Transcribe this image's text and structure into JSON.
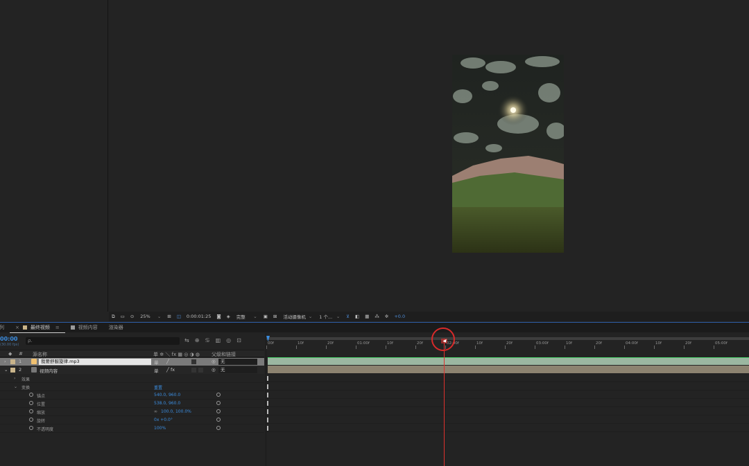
{
  "viewer_bar": {
    "zoom": "25%",
    "timecode": "0:00:01:25",
    "resolution": "完整",
    "camera": "活动摄像机",
    "views": "1 个...",
    "exposure": "+0.0"
  },
  "tabs": [
    {
      "label": "队列"
    },
    {
      "label": "最终视频",
      "active": true
    },
    {
      "label": "视频内容"
    },
    {
      "label": "渲染器"
    }
  ],
  "timeline": {
    "timecode": "00:00",
    "timecode_sub": "(30.00 fps)",
    "search_placeholder": "ρ.",
    "columns": {
      "source_name": "源名称",
      "parent": "父级和链接"
    },
    "layers": [
      {
        "index": "1",
        "name": "我要舒服旋律.mp3",
        "parent": "无",
        "color": "#c9b48a",
        "selected": true
      },
      {
        "index": "2",
        "name": "视频内容",
        "parent": "无",
        "color": "#c9b48a",
        "selected": false
      }
    ],
    "groups": {
      "effects": "效果",
      "transform": "变换",
      "reset": "重置"
    },
    "properties": [
      {
        "name": "锚点",
        "value": "540.0, 960.0"
      },
      {
        "name": "位置",
        "value": "538.0, 960.0"
      },
      {
        "name": "缩放",
        "value": "100.0, 100.0%"
      },
      {
        "name": "旋转",
        "value": "0x +0.0°"
      },
      {
        "name": "不透明度",
        "value": "100%"
      }
    ],
    "ruler_labels": [
      "00f",
      "10f",
      "20f",
      "01:00f",
      "10f",
      "20f",
      "02:00f",
      "10f",
      "20f",
      "03:00f",
      "10f",
      "20f",
      "04:00f",
      "10f",
      "20f",
      "05:00f"
    ]
  },
  "colors": {
    "accent": "#3b8de0",
    "playhead": "#e0312e",
    "audio_bar": "#9bb7a1",
    "video_bar": "#8c8370"
  }
}
